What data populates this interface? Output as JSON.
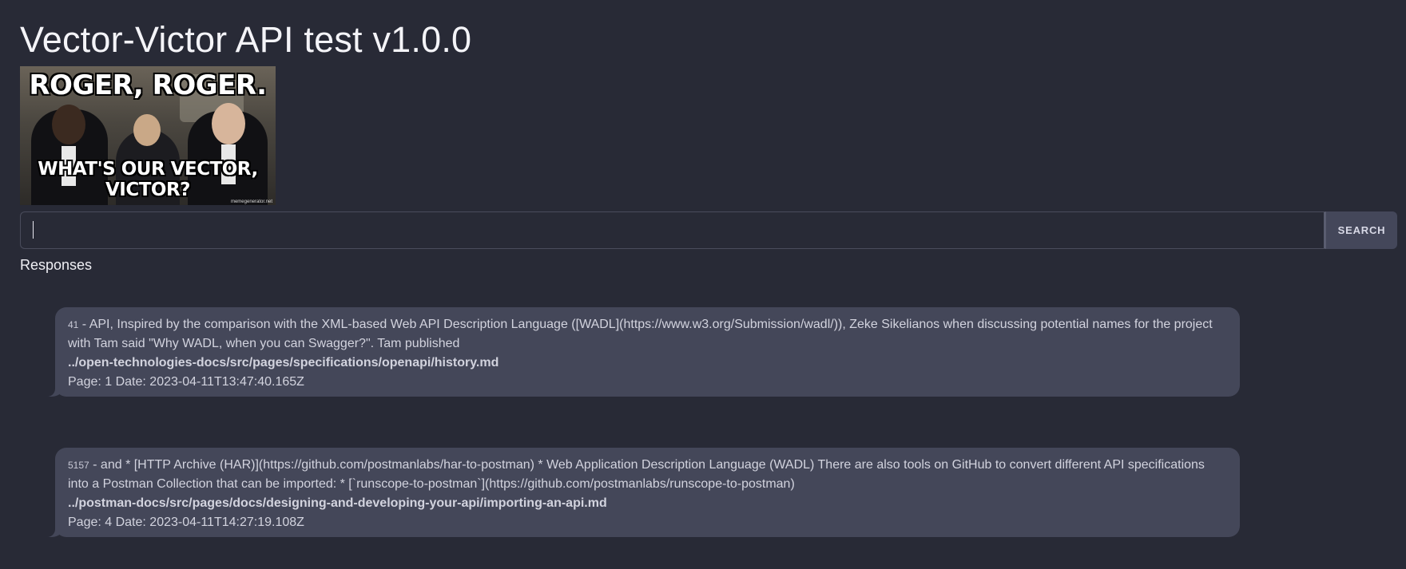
{
  "header": {
    "title": "Vector-Victor API test v1.0.0"
  },
  "meme": {
    "caption_top": "ROGER, ROGER.",
    "caption_bottom": "WHAT'S OUR VECTOR, VICTOR?",
    "watermark": "memegenerator.net"
  },
  "search": {
    "value": "",
    "placeholder": "",
    "button_label": "SEARCH"
  },
  "responses": {
    "label": "Responses",
    "items": [
      {
        "score": "41",
        "text": " - API, Inspired by the comparison with the XML-based Web API Description Language ([WADL](https://www.w3.org/Submission/wadl/)), Zeke Sikelianos when discussing potential names for the project with Tam said \"Why WADL, when you can Swagger?\". Tam published",
        "path": "../open-technologies-docs/src/pages/specifications/openapi/history.md",
        "meta": "Page: 1 Date: 2023-04-11T13:47:40.165Z"
      },
      {
        "score": "5157",
        "text": " - and * [HTTP Archive (HAR)](https://github.com/postmanlabs/har-to-postman) * Web Application Description Language (WADL) There are also tools on GitHub to convert different API specifications into a Postman Collection that can be imported: * [`runscope-to-postman`](https://github.com/postmanlabs/runscope-to-postman)",
        "path": "../postman-docs/src/pages/docs/designing-and-developing-your-api/importing-an-api.md",
        "meta": "Page: 4 Date: 2023-04-11T14:27:19.108Z"
      }
    ]
  },
  "colors": {
    "background": "#282a36",
    "bubble": "#444759",
    "button": "#44475a",
    "text": "#f0f0f5"
  }
}
